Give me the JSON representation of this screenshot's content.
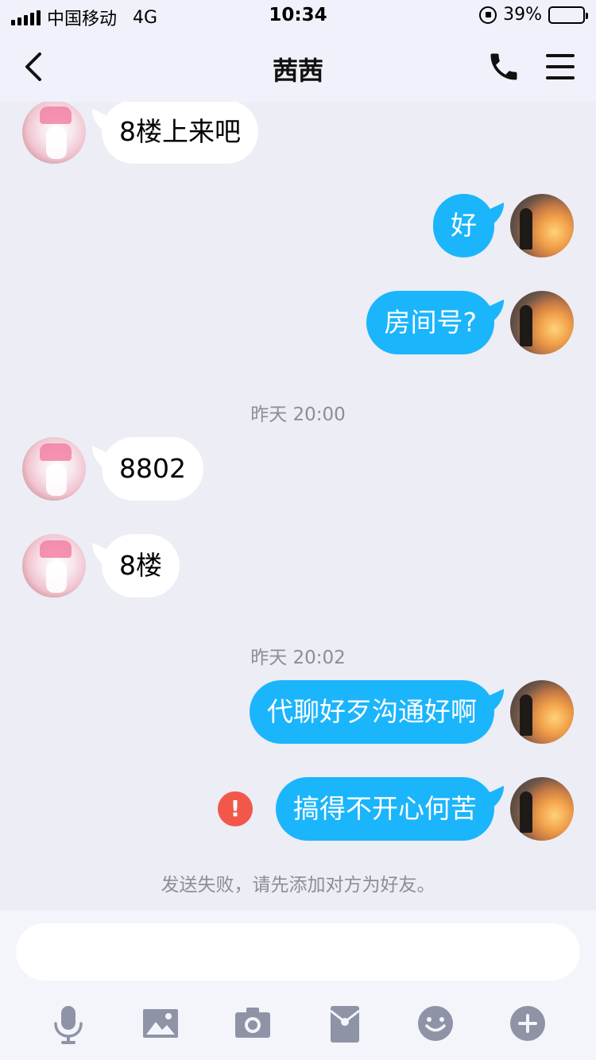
{
  "status_bar": {
    "carrier": "中国移动",
    "network": "4G",
    "time": "10:34",
    "battery": "39%",
    "battery_level": 0.39
  },
  "header": {
    "title": "茜茜",
    "back_icon": "chevron-left-icon",
    "call_icon": "phone-icon",
    "menu_icon": "hamburger-menu-icon"
  },
  "messages": [
    {
      "direction": "in",
      "text": "8楼上来吧"
    },
    {
      "direction": "out",
      "text": "好"
    },
    {
      "direction": "out",
      "text": "房间号?"
    },
    {
      "timestamp": "昨天 20:00"
    },
    {
      "direction": "in",
      "text": "8802"
    },
    {
      "direction": "in",
      "text": "8楼"
    },
    {
      "timestamp": "昨天 20:02"
    },
    {
      "direction": "out",
      "text": "代聊好歹沟通好啊"
    },
    {
      "direction": "out",
      "text": "搞得不开心何苦",
      "failed": true,
      "error_mark": "!"
    }
  ],
  "fail_notice": "发送失败，请先添加对方为好友。",
  "input": {
    "value": "",
    "placeholder": ""
  },
  "toolbar": {
    "icons": [
      "microphone-icon",
      "image-icon",
      "camera-icon",
      "red-packet-icon",
      "emoji-icon",
      "plus-icon"
    ]
  },
  "colors": {
    "outgoing_bubble": "#1bb5fb",
    "incoming_bubble": "#ffffff",
    "background": "#ecedf5",
    "error": "#f1584a",
    "icon_gray": "#8e93a6"
  }
}
